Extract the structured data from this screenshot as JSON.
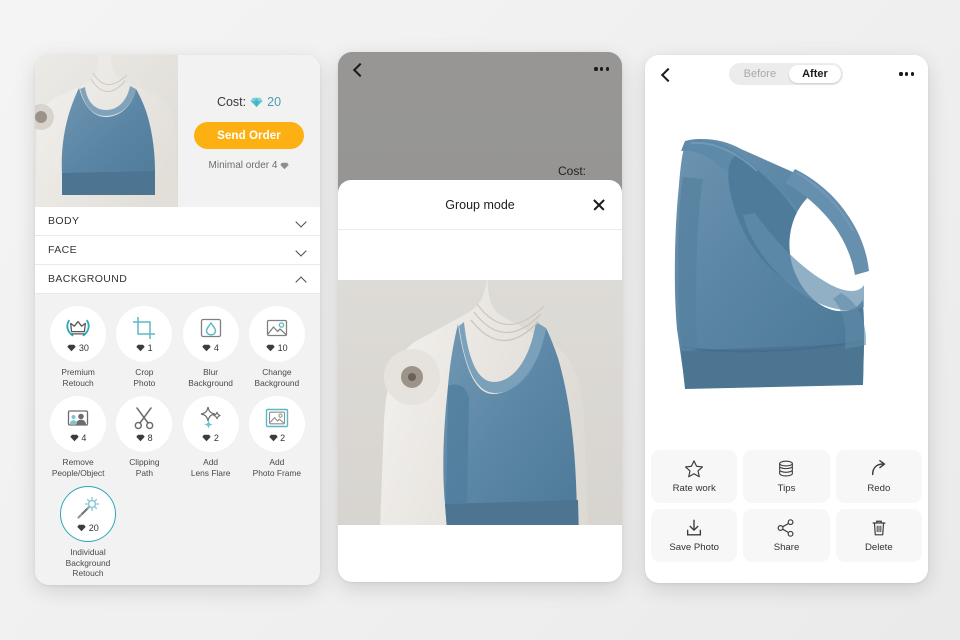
{
  "left_panel": {
    "cost_label": "Cost:",
    "cost_value": "20",
    "send_order_label": "Send Order",
    "minimal_order": "Minimal order 4",
    "accordions": [
      {
        "label": "BODY",
        "state": "collapsed",
        "icon": "chevron-down-icon"
      },
      {
        "label": "FACE",
        "state": "collapsed",
        "icon": "chevron-down-icon"
      },
      {
        "label": "BACKGROUND",
        "state": "expanded",
        "icon": "chevron-up-icon"
      }
    ],
    "services": [
      {
        "label": "Premium\nRetouch",
        "price": "30",
        "icon": "crown-laurel-icon",
        "selected": false
      },
      {
        "label": "Crop\nPhoto",
        "price": "1",
        "icon": "crop-icon",
        "selected": false
      },
      {
        "label": "Blur\nBackground",
        "price": "4",
        "icon": "water-drop-icon",
        "selected": false
      },
      {
        "label": "Change\nBackground",
        "price": "10",
        "icon": "landscape-photo-icon",
        "selected": false
      },
      {
        "label": "Remove\nPeople/Object",
        "price": "4",
        "icon": "remove-person-icon",
        "selected": false
      },
      {
        "label": "Clipping\nPath",
        "price": "8",
        "icon": "scissors-icon",
        "selected": false
      },
      {
        "label": "Add\nLens Flare",
        "price": "2",
        "icon": "sparkle-icon",
        "selected": false
      },
      {
        "label": "Add\nPhoto Frame",
        "price": "2",
        "icon": "photo-frame-icon",
        "selected": false
      }
    ],
    "selected_service": {
      "label": "Individual\nBackground\nRetouch",
      "price": "20",
      "icon": "magic-wand-icon",
      "selected": true
    }
  },
  "middle_panel": {
    "back_icon": "back-chevron-icon",
    "more_icon": "more-options-icon",
    "cost_label": "Cost:",
    "modal": {
      "title": "Group mode",
      "close_icon": "close-icon"
    }
  },
  "right_panel": {
    "back_icon": "back-chevron-icon",
    "more_icon": "more-options-icon",
    "toggle": {
      "before_label": "Before",
      "after_label": "After",
      "selected": "After"
    },
    "actions": [
      {
        "label": "Rate work",
        "icon": "star-icon"
      },
      {
        "label": "Tips",
        "icon": "coins-icon"
      },
      {
        "label": "Redo",
        "icon": "redo-arrow-icon"
      },
      {
        "label": "Save Photo",
        "icon": "download-icon"
      },
      {
        "label": "Share",
        "icon": "share-icon"
      },
      {
        "label": "Delete",
        "icon": "trash-icon"
      }
    ]
  },
  "colors": {
    "accent_teal": "#2aa8b8",
    "gem_teal": "#4cb5c4",
    "order_button": "#fcb012",
    "garment_blue": "#5683a3",
    "panel_bg": "#f2f2f3"
  }
}
